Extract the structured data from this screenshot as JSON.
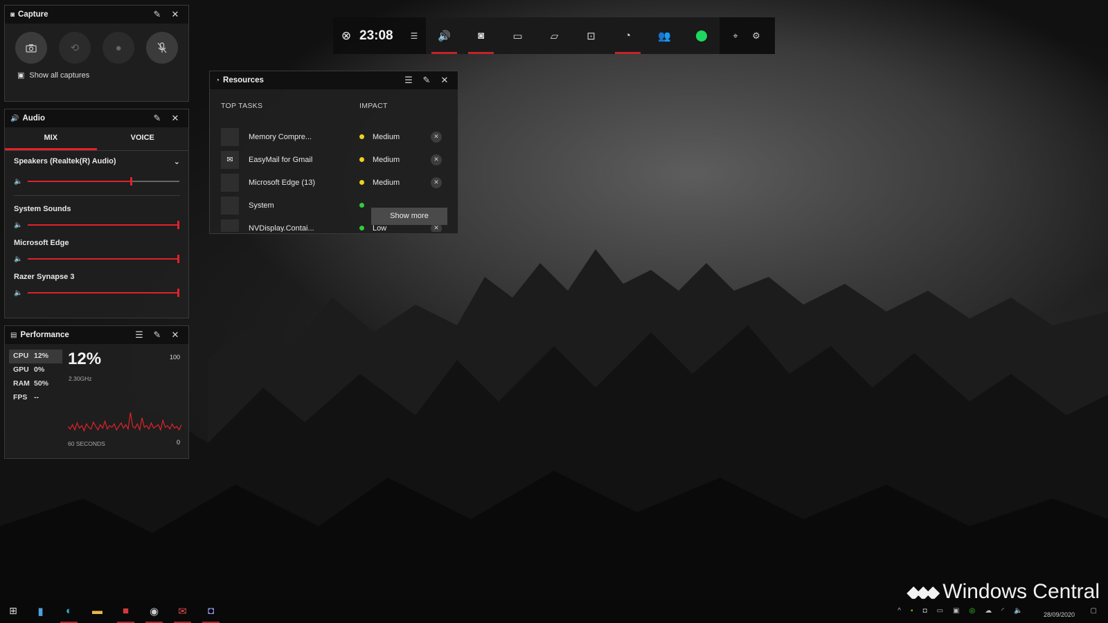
{
  "capture": {
    "title": "Capture",
    "show_all": "Show all captures"
  },
  "audio": {
    "title": "Audio",
    "tabs": [
      "MIX",
      "VOICE"
    ],
    "device": "Speakers (Realtek(R) Audio)",
    "master_volume": 0.68,
    "apps": [
      {
        "name": "System Sounds",
        "volume": 1.0
      },
      {
        "name": "Microsoft Edge",
        "volume": 1.0
      },
      {
        "name": "Razer Synapse 3",
        "volume": 1.0
      }
    ]
  },
  "performance": {
    "title": "Performance",
    "metrics": [
      {
        "key": "CPU",
        "value": "12%"
      },
      {
        "key": "GPU",
        "value": "0%"
      },
      {
        "key": "RAM",
        "value": "50%"
      },
      {
        "key": "FPS",
        "value": "--"
      }
    ],
    "big_value": "12%",
    "frequency": "2.30GHz",
    "max": "100",
    "min": "0",
    "window": "60 SECONDS",
    "cpu_history": [
      12,
      9,
      14,
      8,
      16,
      10,
      13,
      7,
      15,
      11,
      9,
      17,
      12,
      8,
      14,
      10,
      18,
      9,
      13,
      11,
      15,
      8,
      12,
      16,
      10,
      14,
      9,
      28,
      12,
      10,
      15,
      8,
      22,
      11,
      13,
      9,
      16,
      10,
      12,
      14,
      8,
      19,
      11,
      13,
      9,
      15,
      10,
      12,
      8,
      14
    ]
  },
  "gamebar": {
    "time": "23:08"
  },
  "resources": {
    "title": "Resources",
    "col_tasks": "TOP TASKS",
    "col_impact": "IMPACT",
    "rows": [
      {
        "name": "Memory Compre...",
        "impact": "Medium",
        "color": "#f0d020"
      },
      {
        "name": "EasyMail for Gmail",
        "impact": "Medium",
        "color": "#f0d020"
      },
      {
        "name": "Microsoft Edge (13)",
        "impact": "Medium",
        "color": "#f0d020"
      },
      {
        "name": "System",
        "impact": "",
        "color": "#2ecc40"
      },
      {
        "name": "NVDisplay.Contai...",
        "impact": "Low",
        "color": "#2ecc40"
      }
    ],
    "show_more": "Show more"
  },
  "taskbar": {
    "date": "28/09/2020"
  },
  "watermark": "Windows Central"
}
